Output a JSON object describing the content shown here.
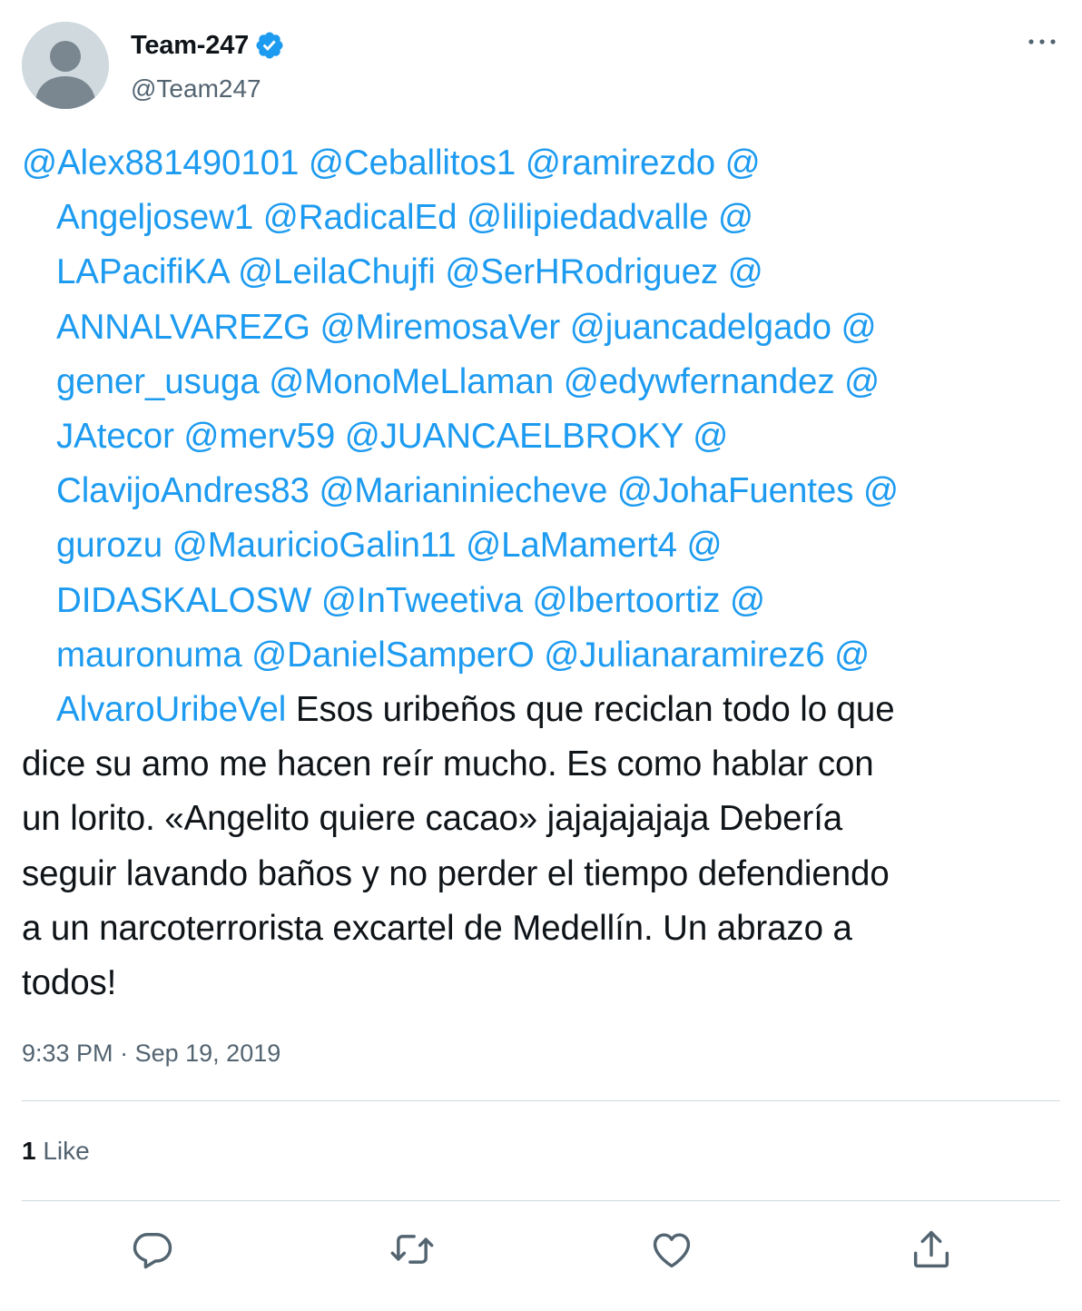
{
  "author": {
    "display_name": "Team-247",
    "handle": "@Team247",
    "verified_icon": "verified-badge-icon",
    "avatar_icon": "default-avatar-icon"
  },
  "tweet": {
    "mention_lines": [
      "@Alex881490101 @Ceballitos1 @ramirezdo @",
      "Angeljosew1 @RadicalEd @lilipiedadvalle @",
      "LAPacifiKA @LeilaChujfi @SerHRodriguez @",
      "ANNALVAREZG @MiremosaVer @juancadelgado @",
      "gener_usuga @MonoMeLlaman @edywfernandez @",
      "JAtecor @merv59 @JUANCAELBROKY @",
      "ClavijoAndres83 @Marianiniecheve @JohaFuentes @",
      "gurozu @MauricioGalin11 @LaMamert4 @",
      "DIDASKALOSW @InTweetiva @lbertoortiz @",
      "mauronuma @DanielSamperO @Julianaramirez6 @",
      "AlvaroUribeVel"
    ],
    "body_lines": [
      "Esos uribeños que reciclan todo lo que",
      "dice su amo me hacen reír mucho. Es como hablar con",
      "un lorito. «Angelito quiere cacao» jajajajajaja Debería",
      "seguir lavando baños y no perder el tiempo defendiendo",
      "a un narcoterrorista excartel de Medellín. Un abrazo a",
      "todos!"
    ],
    "time": "9:33 PM",
    "separator": "·",
    "date": "Sep 19, 2019",
    "likes_count": "1",
    "likes_label": "Like"
  },
  "actions": [
    {
      "name": "reply",
      "icon": "reply-icon"
    },
    {
      "name": "retweet",
      "icon": "retweet-icon"
    },
    {
      "name": "like",
      "icon": "heart-icon"
    },
    {
      "name": "share",
      "icon": "share-icon"
    }
  ],
  "colors": {
    "link": "#1d9bf0",
    "text": "#0f1419",
    "secondary": "#536471",
    "divider": "#cfd9de"
  }
}
